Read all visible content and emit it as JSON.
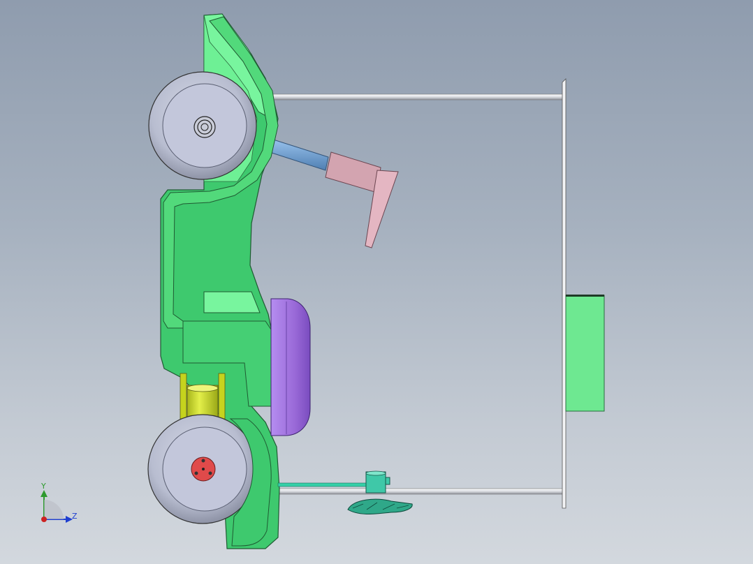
{
  "viewport": {
    "background_top": "#8f9cae",
    "background_bottom": "#d3d8de"
  },
  "triad": {
    "y_label": "Y",
    "z_label": "Z",
    "y_color": "#2e9a2e",
    "z_color": "#1f3fd0",
    "x_color": "#cc2222"
  },
  "model": {
    "body_color": "#3ec96e",
    "body_light_color": "#78f59e",
    "wheel_color": "#c4c8d6",
    "hub_color": "#e04a4a",
    "seat_color": "#a77ae6",
    "pedal_color": "#d9a8b4",
    "cylinder_color": "#c8d82a",
    "rod_color": "#e8eaee",
    "panel_color": "#6ee891"
  }
}
